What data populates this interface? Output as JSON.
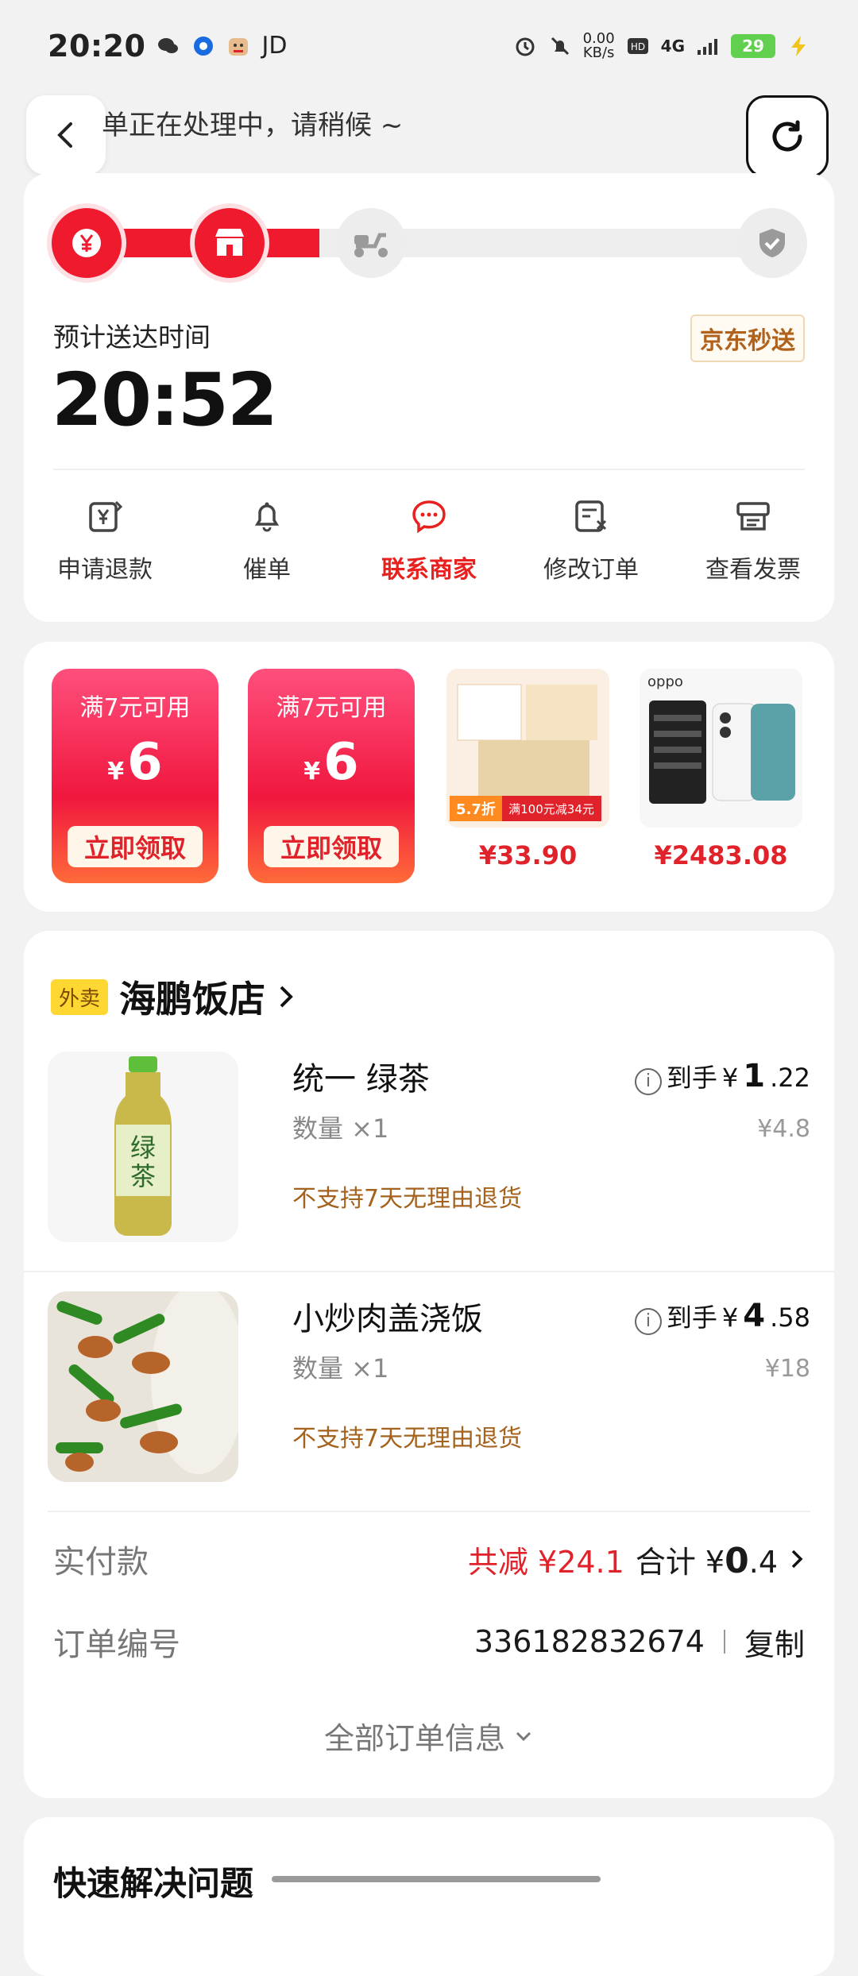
{
  "status_bar": {
    "time": "20:20",
    "carrier_text": "JD",
    "net_speed": "0.00",
    "net_unit": "KB/s",
    "battery": "29",
    "signal": "4G"
  },
  "header": {
    "status_text": "单正在处理中，请稍候 ~"
  },
  "progress": {
    "eta_label": "预计送达时间",
    "eta_time": "20:52",
    "service_tag": "京东秒送",
    "fill_fraction": 0.33,
    "steps": [
      {
        "icon": "yuan-icon",
        "state": "done"
      },
      {
        "icon": "store-icon",
        "state": "done"
      },
      {
        "icon": "scooter-icon",
        "state": "pending"
      },
      {
        "icon": "check-icon",
        "state": "pending"
      }
    ]
  },
  "actions": [
    {
      "label": "申请退款",
      "icon": "refund-icon"
    },
    {
      "label": "催单",
      "icon": "bell-icon"
    },
    {
      "label": "联系商家",
      "icon": "chat-icon",
      "active": true
    },
    {
      "label": "修改订单",
      "icon": "edit-order-icon"
    },
    {
      "label": "查看发票",
      "icon": "invoice-icon"
    }
  ],
  "promos": {
    "coupons": [
      {
        "condition": "满7元可用",
        "currency": "¥",
        "amount": "6",
        "button": "立即领取"
      },
      {
        "condition": "满7元可用",
        "currency": "¥",
        "amount": "6",
        "button": "立即领取"
      }
    ],
    "products": [
      {
        "price": "¥33.90",
        "badge": "5.7折",
        "promo": "满100元减34元"
      },
      {
        "price": "¥2483.08",
        "brand": "oppo"
      }
    ]
  },
  "order": {
    "shop_tag": "外卖",
    "shop_name": "海鹏饭店",
    "items": [
      {
        "name": "统一 绿茶",
        "qty": "数量 ×1",
        "policy": "不支持7天无理由退货",
        "price_prefix": "到手",
        "currency": "¥",
        "price_int": "1",
        "price_dec": ".22",
        "orig": "¥4.8"
      },
      {
        "name": "小炒肉盖浇饭",
        "qty": "数量 ×1",
        "policy": "不支持7天无理由退货",
        "price_prefix": "到手",
        "currency": "¥",
        "price_int": "4",
        "price_dec": ".58",
        "orig": "¥18"
      }
    ],
    "paid_label": "实付款",
    "discount": "共减 ¥24.1",
    "total_prefix": "合计",
    "total_currency": "¥",
    "total_int": "0",
    "total_dec": ".4",
    "order_no_label": "订单编号",
    "order_no": "336182832674",
    "copy_label": "复制",
    "more_label": "全部订单信息"
  },
  "quick": {
    "title": "快速解决问题"
  },
  "colors": {
    "accent_red": "#f01a2e",
    "price_red": "#e0222a",
    "policy_brown": "#a5621d"
  }
}
